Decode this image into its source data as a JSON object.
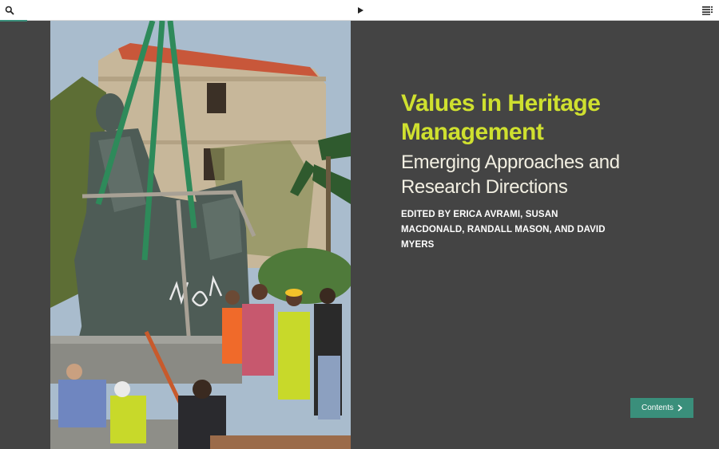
{
  "toolbar": {
    "search_icon": "search-icon",
    "play_icon": "play-icon",
    "toc_icon": "table-of-contents-icon"
  },
  "cover": {
    "description_icon": "statue-photo"
  },
  "book": {
    "title": "Values in Heritage Management",
    "subtitle": "Emerging Approaches and Research Directions",
    "editors": "EDITED BY ERICA AVRAMI, SUSAN MACDONALD, RANDALL MASON, AND DAVID MYERS"
  },
  "navigation": {
    "contents_label": "Contents"
  },
  "colors": {
    "background": "#444444",
    "title": "#cfe02f",
    "accent": "#3a8f7b"
  }
}
